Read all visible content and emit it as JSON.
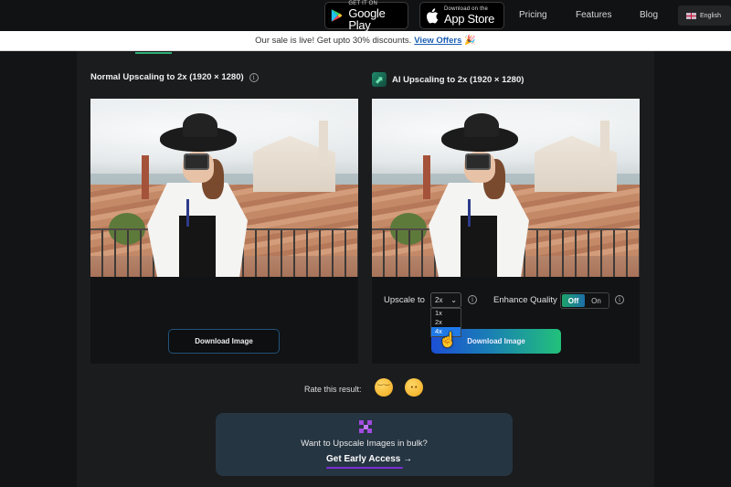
{
  "nav": {
    "google_play": {
      "small": "GET IT ON",
      "big": "Google Play"
    },
    "app_store": {
      "small": "Download on the",
      "big": "App Store"
    },
    "links": [
      "Pricing",
      "Features",
      "Blog"
    ],
    "language": "English"
  },
  "banner": {
    "text": "Our sale is live! Get upto 30% discounts.",
    "link": "View Offers",
    "emoji": "🎉"
  },
  "normal": {
    "title": "Normal Upscaling to 2x (1920 × 1280)",
    "download_label": "Download Image"
  },
  "ai": {
    "title": "AI Upscaling to 2x (1920 × 1280)",
    "upscale_label": "Upscale to",
    "upscale_value": "2x",
    "upscale_options": [
      "1x",
      "2x",
      "4x"
    ],
    "upscale_highlighted": "4x",
    "enhance_label": "Enhance Quality",
    "toggle_off": "Off",
    "toggle_on": "On",
    "toggle_state": "Off",
    "download_label": "Download Image"
  },
  "rate": {
    "label": "Rate this result:"
  },
  "bulk": {
    "text": "Want to Upscale Images in bulk?",
    "link": "Get Early Access →"
  },
  "colors": {
    "accent_green": "#2fae76",
    "link_blue": "#1a5fb4",
    "bulk_bg": "#263542",
    "purple": "#a24be0"
  }
}
